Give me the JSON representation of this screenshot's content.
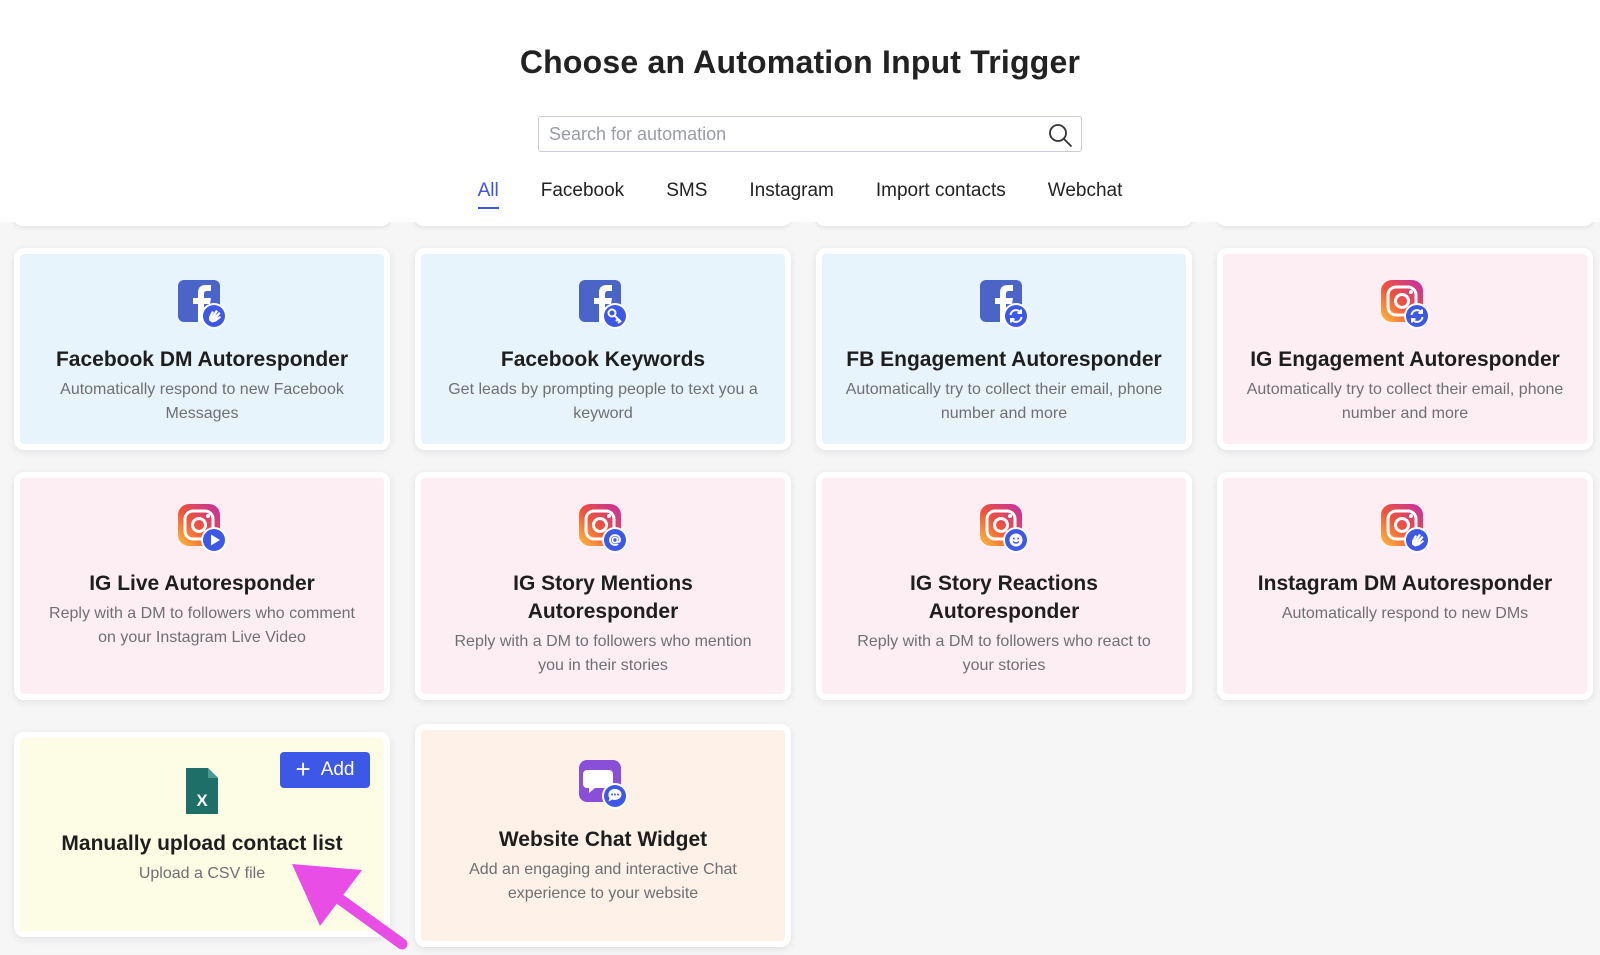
{
  "header": {
    "title": "Choose an Automation Input Trigger",
    "search_placeholder": "Search for automation"
  },
  "tabs": [
    {
      "label": "All",
      "active": true
    },
    {
      "label": "Facebook",
      "active": false
    },
    {
      "label": "SMS",
      "active": false
    },
    {
      "label": "Instagram",
      "active": false
    },
    {
      "label": "Import contacts",
      "active": false
    },
    {
      "label": "Webchat",
      "active": false
    }
  ],
  "cards": [
    {
      "title": "Facebook DM Autoresponder",
      "description": "Automatically respond to new Facebook Messages",
      "icon": "facebook-wave-icon"
    },
    {
      "title": "Facebook Keywords",
      "description": "Get leads by prompting people to text you a keyword",
      "icon": "facebook-key-icon"
    },
    {
      "title": "FB Engagement Autoresponder",
      "description": "Automatically try to collect their email, phone number and more",
      "icon": "facebook-sync-icon"
    },
    {
      "title": "IG Engagement Autoresponder",
      "description": "Automatically try to collect their email, phone number and more",
      "icon": "instagram-sync-icon"
    },
    {
      "title": "IG Live Autoresponder",
      "description": "Reply with a DM to followers who comment on your Instagram Live Video",
      "icon": "instagram-play-icon"
    },
    {
      "title": "IG Story Mentions Autoresponder",
      "description": "Reply with a DM to followers who mention you in their stories",
      "icon": "instagram-at-icon"
    },
    {
      "title": "IG Story Reactions Autoresponder",
      "description": "Reply with a DM to followers who react to your stories",
      "icon": "instagram-smile-icon"
    },
    {
      "title": "Instagram DM Autoresponder",
      "description": "Automatically respond to new DMs",
      "icon": "instagram-wave-icon"
    },
    {
      "title": "Manually upload contact list",
      "description": "Upload a CSV file",
      "icon": "excel-file-icon",
      "add_label": "Add"
    },
    {
      "title": "Website Chat Widget",
      "description": "Add an engaging and interactive Chat experience to your website",
      "icon": "chat-bubble-icon"
    }
  ],
  "colors": {
    "accent": "#3d58e6",
    "facebook_card_bg": "#e8f4fc",
    "instagram_card_bg": "#fdeef4",
    "upload_card_bg": "#fdfde5",
    "chat_card_bg": "#fdf1e8",
    "arrow": "#e84ee6"
  }
}
